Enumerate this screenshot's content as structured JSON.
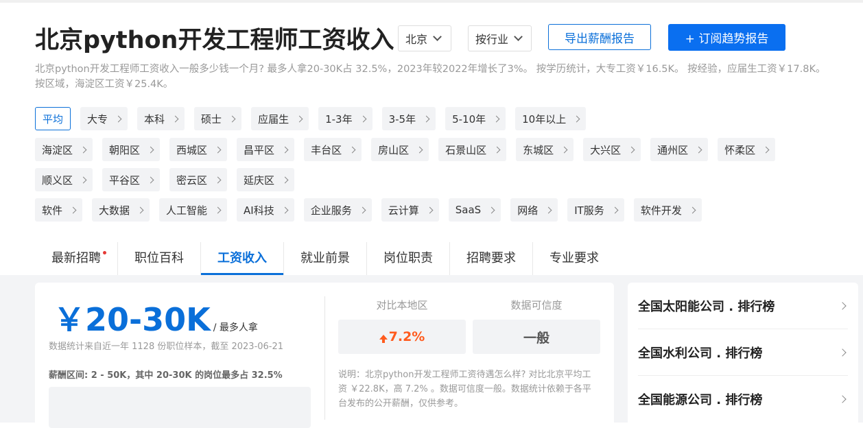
{
  "header": {
    "title": "北京python开发工程师工资收入",
    "city_select": "北京",
    "industry_select": "按行业",
    "export_button": "导出薪酬报告",
    "subscribe_button": "+ 订阅趋势报告"
  },
  "description": "北京python开发工程师工资收入一般多少钱一个月? 最多人拿20-30K占 32.5%，2023年较2022年增长了3%。 按学历统计，大专工资￥16.5K。 按经验，应届生工资￥17.8K。 按区域，海淀区工资￥25.4K。",
  "filters": {
    "row1": [
      "平均",
      "大专",
      "本科",
      "硕士",
      "应届生",
      "1-3年",
      "3-5年",
      "5-10年",
      "10年以上"
    ],
    "row2": [
      "海淀区",
      "朝阳区",
      "西城区",
      "昌平区",
      "丰台区",
      "房山区",
      "石景山区",
      "东城区",
      "大兴区",
      "通州区",
      "怀柔区"
    ],
    "row3": [
      "顺义区",
      "平谷区",
      "密云区",
      "延庆区"
    ],
    "row4": [
      "软件",
      "大数据",
      "人工智能",
      "AI科技",
      "企业服务",
      "云计算",
      "SaaS",
      "网络",
      "IT服务",
      "软件开发"
    ]
  },
  "tabs": [
    "最新招聘",
    "职位百科",
    "工资收入",
    "就业前景",
    "岗位职责",
    "招聘要求",
    "专业要求"
  ],
  "active_tab": "工资收入",
  "salary": {
    "value": "￥20-30K",
    "note": "/ 最多人拿",
    "stat_note": "数据统计来自近一年 1128 份职位样本，截至 2023-06-21",
    "range_note": "薪酬区间: 2 - 50K，其中 20-30K 的岗位最多占 32.5%"
  },
  "compare": {
    "local_label": "对比本地区",
    "local_value": "7.2%",
    "trust_label": "数据可信度",
    "trust_value": "一般",
    "explain": "说明：北京python开发工程师工资待遇怎么样? 对比北京平均工资 ￥22.8K，高 7.2% 。数据可信度一般。数据统计依赖于各平台发布的公开薪酬，仅供参考。"
  },
  "rankings": [
    "全国太阳能公司 . 排行榜",
    "全国水利公司 . 排行榜",
    "全国能源公司 . 排行榜"
  ],
  "colors": {
    "accent": "#0a6fd9",
    "up": "#ff5b1e",
    "bg_gray": "#f3f4f6"
  }
}
